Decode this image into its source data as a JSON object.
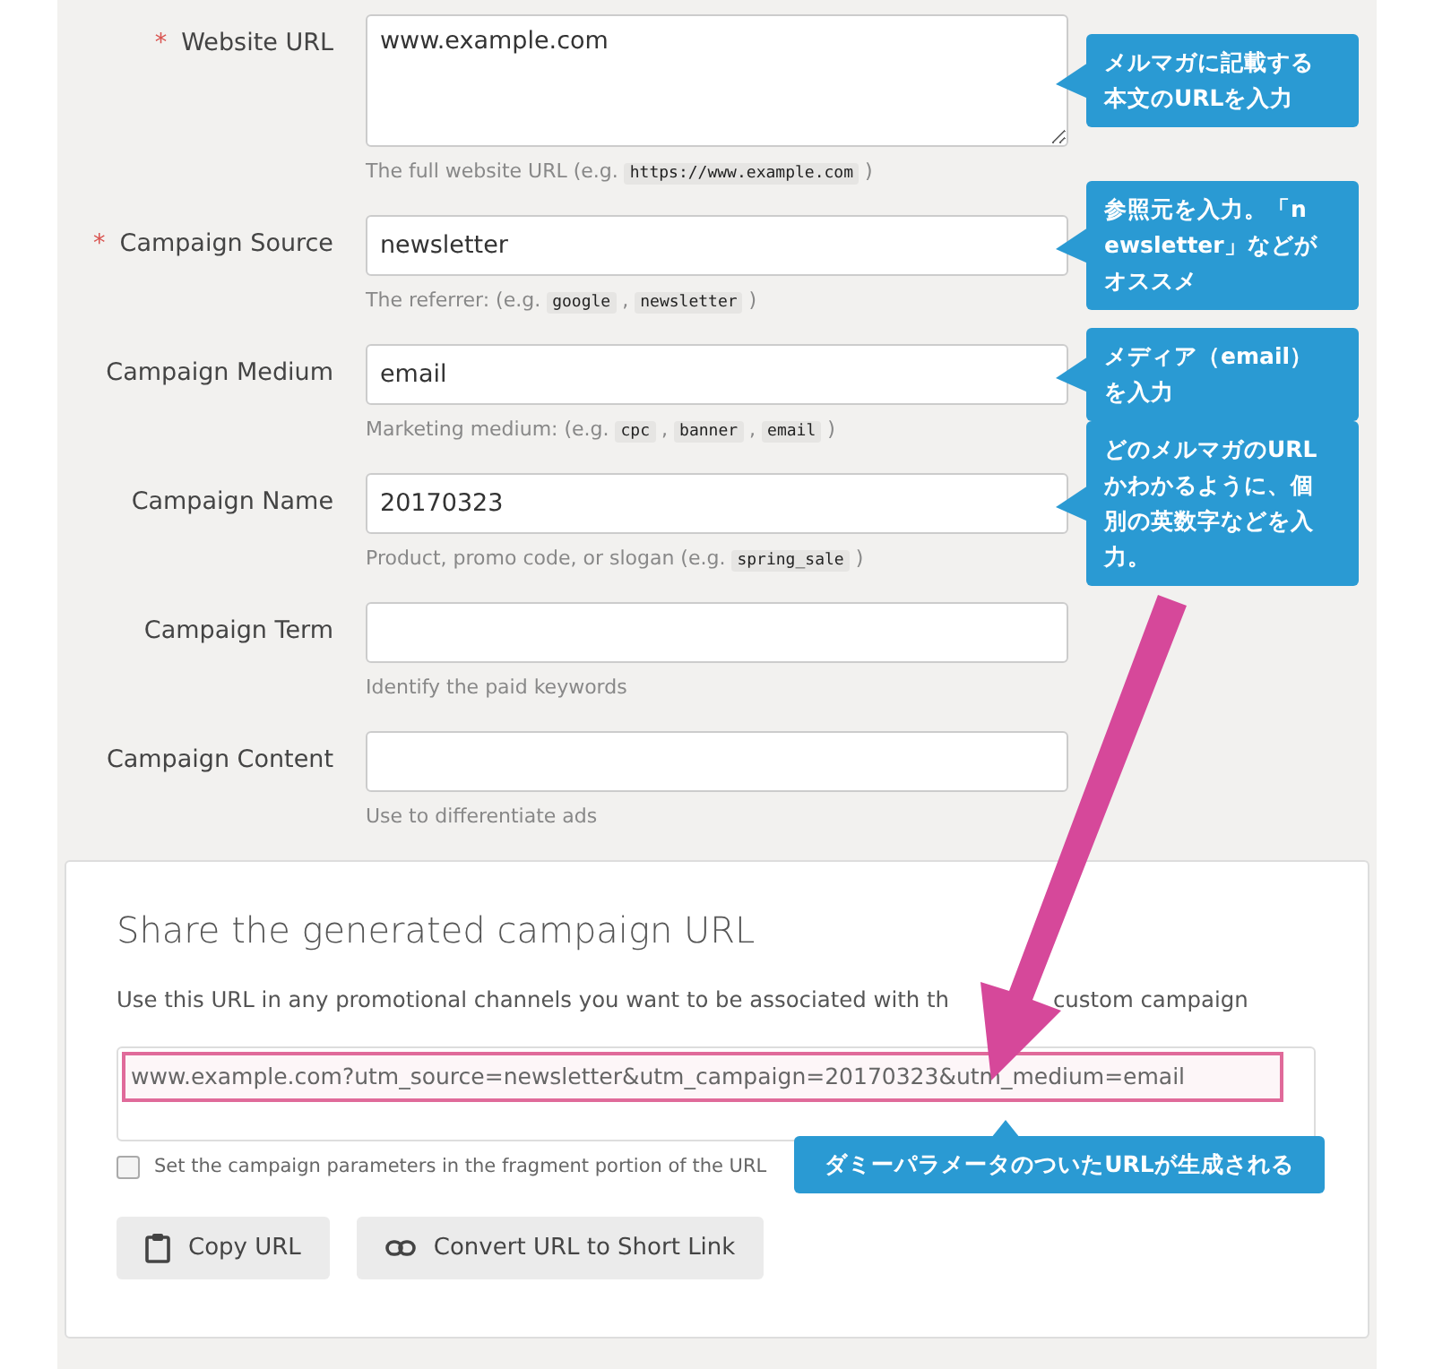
{
  "fields": [
    {
      "label": "Website URL",
      "required_mark": "*",
      "kind": "textarea",
      "value": "www.example.com",
      "hint": [
        {
          "kind": "text",
          "text": "The full website URL (e.g. "
        },
        {
          "kind": "code",
          "text": "https://www.example.com"
        },
        {
          "kind": "text",
          "text": " )"
        }
      ],
      "callout": "メルマガに記載する本文のURLを入力"
    },
    {
      "label": "Campaign Source",
      "required_mark": "*",
      "kind": "input",
      "value": "newsletter",
      "hint": [
        {
          "kind": "text",
          "text": "The referrer: (e.g. "
        },
        {
          "kind": "code",
          "text": "google"
        },
        {
          "kind": "text",
          "text": " , "
        },
        {
          "kind": "code",
          "text": "newsletter"
        },
        {
          "kind": "text",
          "text": " )"
        }
      ],
      "callout": "参照元を入力。「newsletter」などがオススメ"
    },
    {
      "label": "Campaign Medium",
      "kind": "input",
      "value": "email",
      "hint": [
        {
          "kind": "text",
          "text": "Marketing medium: (e.g. "
        },
        {
          "kind": "code",
          "text": "cpc"
        },
        {
          "kind": "text",
          "text": " , "
        },
        {
          "kind": "code",
          "text": "banner"
        },
        {
          "kind": "text",
          "text": " , "
        },
        {
          "kind": "code",
          "text": "email"
        },
        {
          "kind": "text",
          "text": " )"
        }
      ],
      "callout": "メディア（email）を入力"
    },
    {
      "label": "Campaign Name",
      "kind": "input",
      "value": "20170323",
      "hint": [
        {
          "kind": "text",
          "text": "Product, promo code, or slogan (e.g. "
        },
        {
          "kind": "code",
          "text": "spring_sale"
        },
        {
          "kind": "text",
          "text": " )"
        }
      ],
      "callout": "どのメルマガのURLかわかるように、個別の英数字などを入力。"
    },
    {
      "label": "Campaign Term",
      "kind": "input",
      "hint": [
        {
          "kind": "text",
          "text": "Identify the paid keywords"
        }
      ]
    },
    {
      "label": "Campaign Content",
      "kind": "input",
      "hint": [
        {
          "kind": "text",
          "text": "Use to differentiate ads"
        }
      ]
    }
  ],
  "share": {
    "title": "Share the generated campaign URL",
    "description": [
      "Use this URL in any promotional channels you want to be associated with th",
      "custom campaign"
    ],
    "url": "www.example.com?utm_source=newsletter&utm_campaign=20170323&utm_medium=email",
    "url_callout": "ダミーパラメータのついたURLが生成される",
    "fragment_option": {
      "label": "Set the campaign parameters in the fragment portion of the URL",
      "checked": false
    },
    "buttons": [
      {
        "kind": "copy",
        "label": "Copy URL"
      },
      {
        "kind": "shorten",
        "label": "Convert URL to Short Link"
      }
    ]
  }
}
